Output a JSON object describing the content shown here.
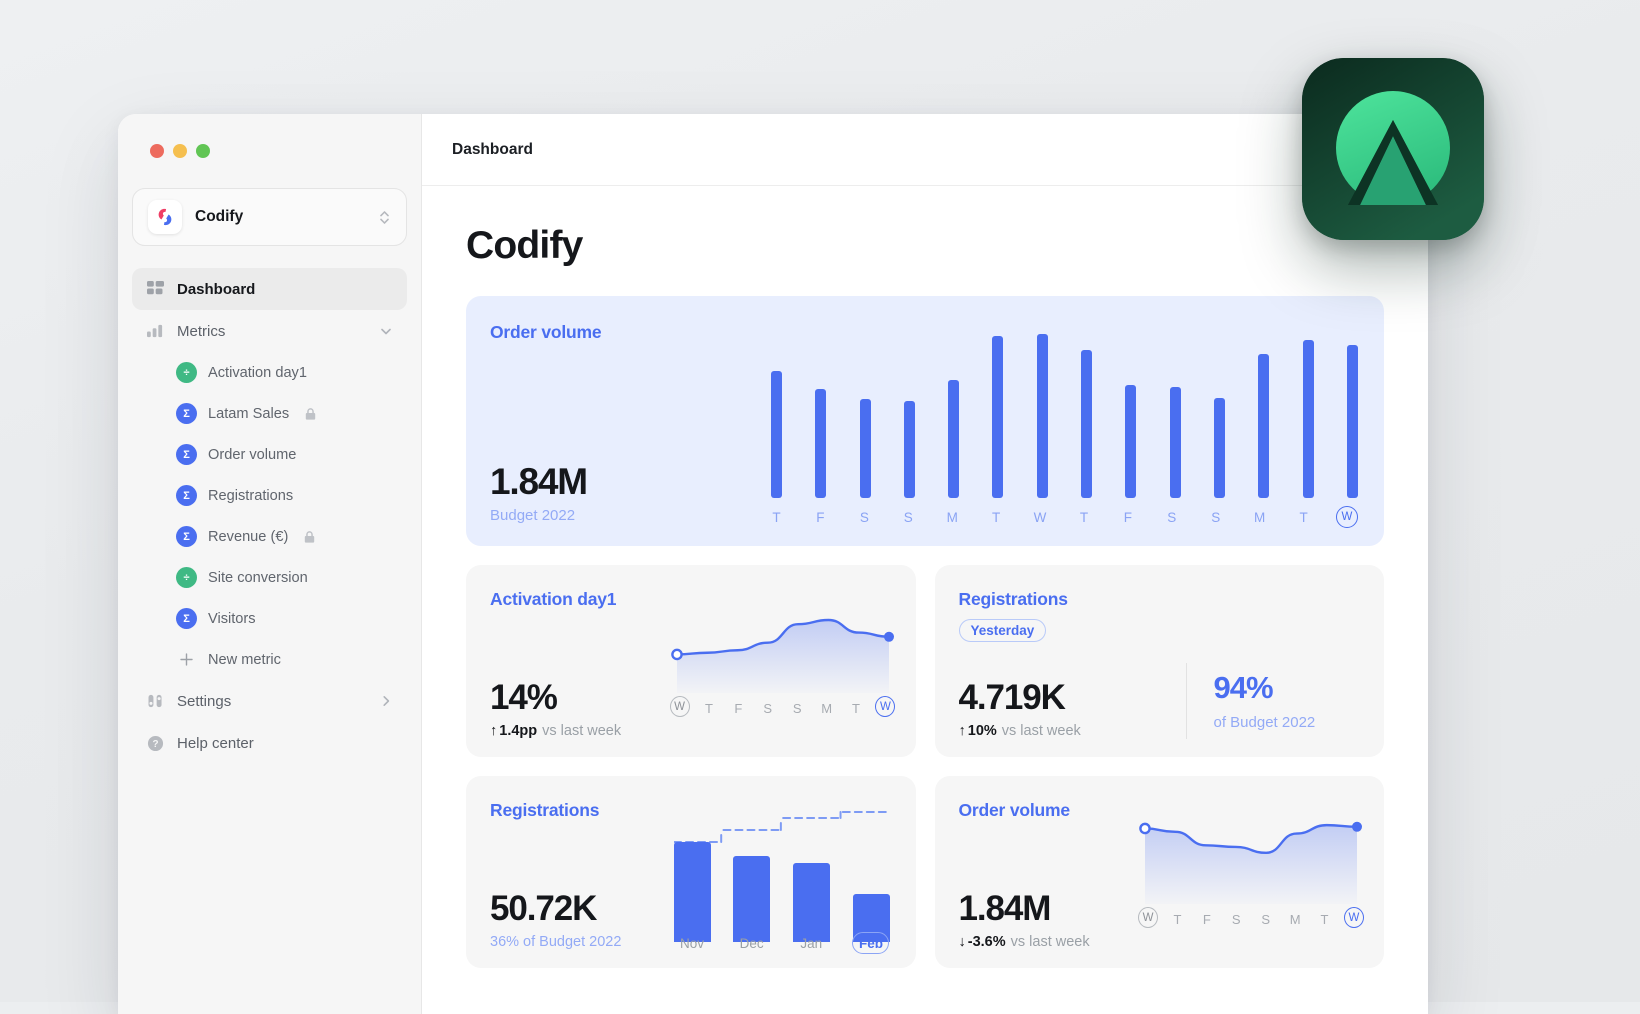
{
  "window": {
    "traffic_lights": [
      "close",
      "minimize",
      "zoom"
    ],
    "topbar_title": "Dashboard"
  },
  "sidebar": {
    "workspace": {
      "name": "Codify",
      "switcher_icon": "chevron-updown-icon"
    },
    "nav": [
      {
        "label": "Dashboard",
        "icon": "dashboard-icon",
        "active": true
      },
      {
        "label": "Metrics",
        "icon": "bar-chart-icon",
        "caret": "chevron-down-icon",
        "active": false
      }
    ],
    "metrics": [
      {
        "label": "Activation day1",
        "badge": "divide-icon",
        "badge_color": "#3fb984",
        "locked": false
      },
      {
        "label": "Latam Sales",
        "badge": "sigma-icon",
        "badge_color": "#4a6ef0",
        "locked": true
      },
      {
        "label": "Order volume",
        "badge": "sigma-icon",
        "badge_color": "#4a6ef0",
        "locked": false
      },
      {
        "label": "Registrations",
        "badge": "sigma-icon",
        "badge_color": "#4a6ef0",
        "locked": false
      },
      {
        "label": "Revenue (€)",
        "badge": "sigma-icon",
        "badge_color": "#4a6ef0",
        "locked": true
      },
      {
        "label": "Site conversion",
        "badge": "divide-icon",
        "badge_color": "#3fb984",
        "locked": false
      },
      {
        "label": "Visitors",
        "badge": "sigma-icon",
        "badge_color": "#4a6ef0",
        "locked": false
      },
      {
        "label": "New metric",
        "badge": "plus-icon",
        "badge_color": "",
        "locked": false
      }
    ],
    "bottom": [
      {
        "label": "Settings",
        "icon": "sliders-icon",
        "caret": "chevron-right-icon"
      },
      {
        "label": "Help center",
        "icon": "question-circle-icon",
        "caret": ""
      }
    ]
  },
  "page": {
    "title": "Codify"
  },
  "colors": {
    "accent": "#4a6ef0",
    "accent_light": "#93aaf6",
    "hero_bg": "#e8eefe",
    "card_bg": "#f6f6f6",
    "green": "#3fb984"
  },
  "hero": {
    "title": "Order volume",
    "value": "1.84M",
    "caption": "Budget 2022"
  },
  "cards": [
    {
      "title": "Activation day1",
      "value": "14%",
      "delta_arrow": "↑",
      "delta_value": "1.4pp",
      "delta_suffix": "vs last week"
    },
    {
      "title": "Registrations",
      "pill": "Yesterday",
      "value": "4.719K",
      "delta_arrow": "↑",
      "delta_value": "10%",
      "delta_suffix": "vs last week",
      "side_value": "94%",
      "side_label": "of Budget 2022"
    },
    {
      "title": "Registrations",
      "value": "50.72K",
      "caption": "36% of Budget 2022"
    },
    {
      "title": "Order volume",
      "value": "1.84M",
      "delta_arrow": "↓",
      "delta_value": "-3.6%",
      "delta_suffix": "vs last week"
    }
  ],
  "chart_data": [
    {
      "id": "hero-order-volume",
      "type": "bar",
      "title": "Order volume",
      "xlabel": "",
      "ylabel": "",
      "categories": [
        "T",
        "F",
        "S",
        "S",
        "M",
        "T",
        "W",
        "T",
        "F",
        "S",
        "S",
        "M",
        "T",
        "W"
      ],
      "values": [
        72,
        62,
        56,
        55,
        67,
        92,
        93,
        84,
        64,
        63,
        57,
        82,
        90,
        87
      ],
      "ylim": [
        0,
        100
      ],
      "grid": false,
      "highlight_last_label": true,
      "bar_color": "#4a6ef0"
    },
    {
      "id": "activation-day1-spark",
      "type": "area",
      "title": "Activation day1",
      "x": [
        "W",
        "T",
        "F",
        "S",
        "S",
        "M",
        "T",
        "W"
      ],
      "values": [
        34,
        36,
        39,
        48,
        70,
        75,
        60,
        55
      ],
      "ylim": [
        0,
        100
      ],
      "grid": false,
      "line_color": "#4a6ef0",
      "endpoints": [
        "hollow",
        "filled"
      ]
    },
    {
      "id": "registrations-months",
      "type": "bar",
      "title": "Registrations",
      "categories": [
        "Nov",
        "Dec",
        "Jan",
        "Feb"
      ],
      "values": [
        100,
        86,
        79,
        48
      ],
      "target_line": [
        100,
        112,
        124,
        130
      ],
      "ylim": [
        0,
        140
      ],
      "grid": false,
      "bar_color": "#4a6ef0",
      "highlight_last_label": true
    },
    {
      "id": "order-volume-spark",
      "type": "area",
      "title": "Order volume",
      "x": [
        "W",
        "T",
        "F",
        "S",
        "S",
        "M",
        "T",
        "W"
      ],
      "values": [
        78,
        74,
        58,
        56,
        49,
        72,
        82,
        80
      ],
      "ylim": [
        0,
        100
      ],
      "grid": false,
      "line_color": "#4a6ef0",
      "endpoints": [
        "hollow",
        "filled"
      ]
    }
  ],
  "app_logo": {
    "name": "mountain-arrow-logo",
    "bg": "#0f3a2a",
    "fg": "#3ddc91"
  }
}
